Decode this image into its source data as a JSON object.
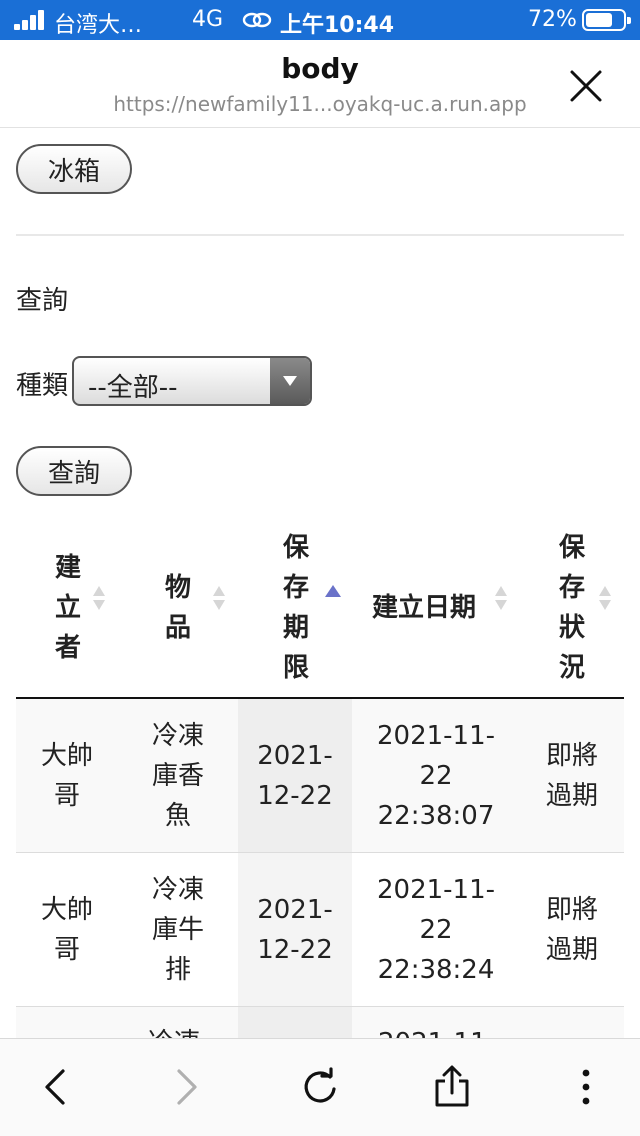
{
  "status_bar": {
    "carrier": "台湾大…",
    "network": "4G",
    "time": "上午10:44",
    "battery": "72%",
    "battery_level": 0.72
  },
  "header": {
    "title": "body",
    "url": "https://newfamily11...oyakq-uc.a.run.app"
  },
  "content": {
    "fridge_button": "冰箱",
    "query_heading": "查詢",
    "kind_label": "種類",
    "kind_select_value": "--全部--",
    "query_button": "查詢"
  },
  "table": {
    "columns": [
      {
        "label": "建立者",
        "sorted": false
      },
      {
        "label": "物品",
        "sorted": false
      },
      {
        "label": "保存期限",
        "sorted": "asc"
      },
      {
        "label": "建立日期",
        "sorted": false
      },
      {
        "label": "保存狀況",
        "sorted": false
      }
    ],
    "rows": [
      {
        "creator": "大帥哥",
        "item": "冷凍庫香魚",
        "expiry": "2021-12-22",
        "created": "2021-11-22 22:38:07",
        "status": "即將過期"
      },
      {
        "creator": "大帥哥",
        "item": "冷凍庫牛排",
        "expiry": "2021-12-22",
        "created": "2021-11-22 22:38:24",
        "status": "即將過期"
      }
    ],
    "partial_row": {
      "item": "冷凍",
      "created": "2021-11-"
    }
  },
  "toolbar": {
    "icons": [
      "back-icon",
      "forward-icon",
      "reload-icon",
      "share-icon",
      "more-icon"
    ]
  },
  "colors": {
    "status_bar": "#1a6fd6",
    "sorted_column": "#eeeeee",
    "sort_active": "#6a72c9"
  }
}
